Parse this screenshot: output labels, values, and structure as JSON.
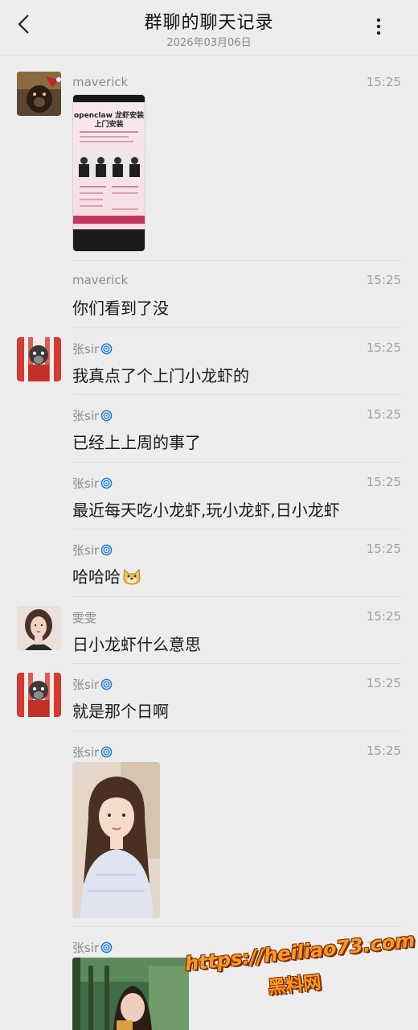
{
  "header": {
    "title": "群聊的聊天记录",
    "date": "2026年03月06日",
    "back_icon": "chevron-left-icon",
    "more_icon": "more-vertical-icon"
  },
  "messages": [
    {
      "sender": "maverick",
      "time": "15:25",
      "type": "image",
      "avatar": "maverick",
      "image": {
        "title_line1": "openclaw 龙虾安装",
        "title_line2": "上门安装"
      }
    },
    {
      "sender": "maverick",
      "time": "15:25",
      "type": "text",
      "text": "你们看到了没"
    },
    {
      "sender": "张sir",
      "time": "15:25",
      "type": "text",
      "text": "我真点了个上门小龙虾的",
      "avatar": "zhangsir"
    },
    {
      "sender": "张sir",
      "time": "15:25",
      "type": "text",
      "text": "已经上上周的事了"
    },
    {
      "sender": "张sir",
      "time": "15:25",
      "type": "text",
      "text": "最近每天吃小龙虾,玩小龙虾,日小龙虾"
    },
    {
      "sender": "张sir",
      "time": "15:25",
      "type": "text",
      "text": "哈哈哈",
      "emoji": "doge"
    },
    {
      "sender": "雯雯",
      "time": "15:25",
      "type": "text",
      "text": "日小龙虾什么意思",
      "avatar": "wenwen"
    },
    {
      "sender": "张sir",
      "time": "15:25",
      "type": "text",
      "text": "就是那个日啊",
      "avatar": "zhangsir"
    },
    {
      "sender": "张sir",
      "time": "15:25",
      "type": "image"
    },
    {
      "sender": "张sir",
      "time": "15:25",
      "type": "image"
    }
  ],
  "watermark": {
    "url": "https://heiliao73.com",
    "name": "黑料网"
  },
  "colors": {
    "background": "#ededed",
    "text": "#191919",
    "meta": "#8b8b8b",
    "swirl": "#1f7bd6"
  }
}
